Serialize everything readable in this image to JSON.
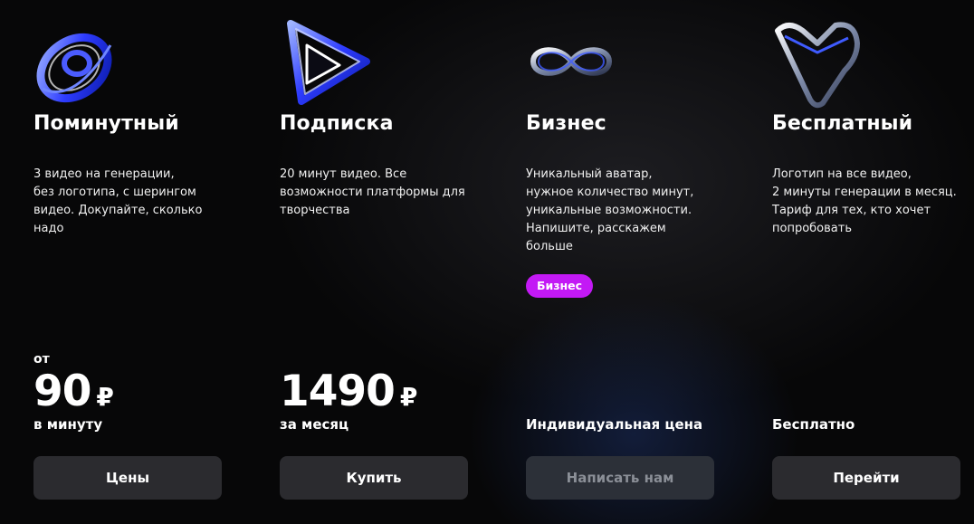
{
  "plans": [
    {
      "title": "Поминутный",
      "description": "3 видео на генерации,\nбез логотипа, с шерингом\nвидео. Докупайте, сколько\nнадо",
      "price_prefix": "от",
      "price": "90",
      "currency": "₽",
      "period": "в минуту",
      "button": "Цены",
      "icon": "orbit-ring-icon"
    },
    {
      "title": "Подписка",
      "description": "20 минут видео. Все\nвозможности платформы для\nтворчества",
      "price": "1490",
      "currency": "₽",
      "period": "за месяц",
      "button": "Купить",
      "icon": "play-triangle-icon"
    },
    {
      "title": "Бизнес",
      "description": "Уникальный аватар,\nнужное количество минут,\nуникальные возможности.\nНапишите, расскажем\nбольше",
      "badge": "Бизнес",
      "period": "Индивидуальная цена",
      "button": "Написать нам",
      "button_disabled": true,
      "icon": "infinity-icon"
    },
    {
      "title": "Бесплатный",
      "description": "Логотип на все видео,\n2 минуты генерации в месяц.\nТариф для тех, кто хочет\nпопробовать",
      "period": "Бесплатно",
      "button": "Перейти",
      "icon": "triangle-heart-icon"
    }
  ],
  "colors": {
    "background": "#070708",
    "badge": "#c319f5",
    "button": "#2b2b2f",
    "button_disabled": "#2c3038",
    "icon_glow": "#3a4dff"
  }
}
